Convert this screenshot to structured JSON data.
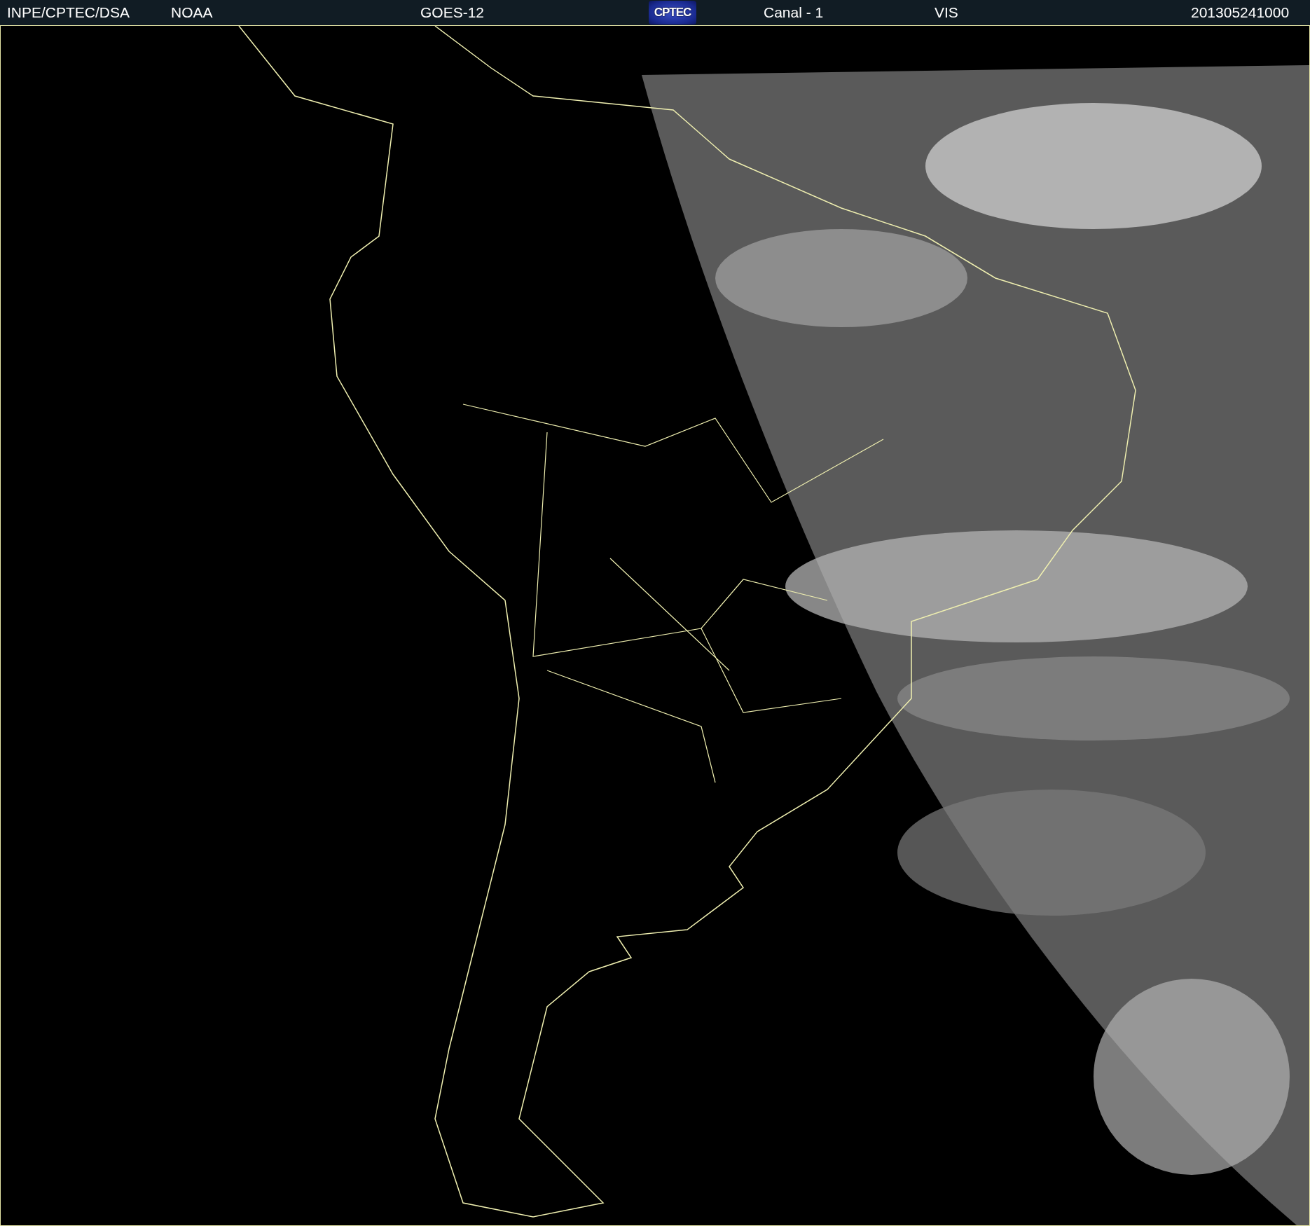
{
  "header": {
    "items": [
      {
        "kind": "text",
        "text": "INPE/CPTEC/DSA"
      },
      {
        "kind": "text",
        "text": "NOAA"
      },
      {
        "kind": "text",
        "text": "GOES-12"
      },
      {
        "kind": "logo",
        "text": "CPTEC"
      },
      {
        "kind": "text",
        "text": "Canal - 1"
      },
      {
        "kind": "text",
        "text": "VIS"
      },
      {
        "kind": "text",
        "text": "201305241000"
      }
    ]
  }
}
